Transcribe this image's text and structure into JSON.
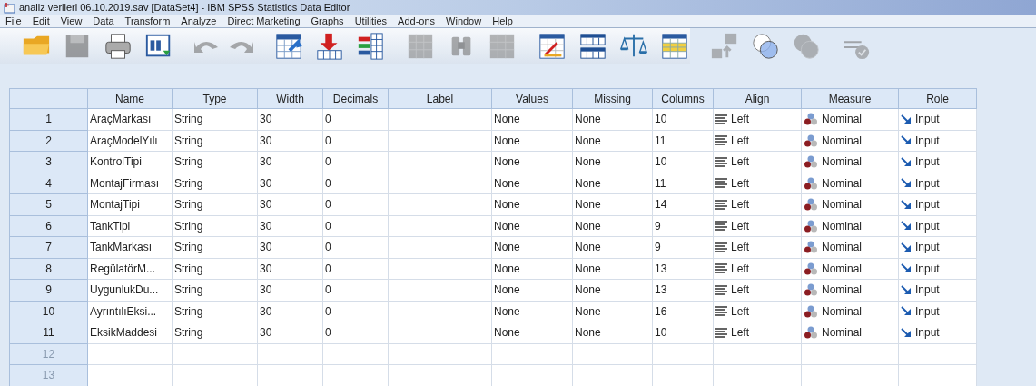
{
  "window": {
    "title": "analiz verileri 06.10.2019.sav [DataSet4] - IBM SPSS Statistics Data Editor"
  },
  "menu": [
    "File",
    "Edit",
    "View",
    "Data",
    "Transform",
    "Analyze",
    "Direct Marketing",
    "Graphs",
    "Utilities",
    "Add-ons",
    "Window",
    "Help"
  ],
  "toolbar": [
    {
      "kind": "open",
      "disabled": false
    },
    {
      "kind": "save",
      "disabled": true
    },
    {
      "kind": "print",
      "disabled": false
    },
    {
      "kind": "recall",
      "disabled": false
    },
    {
      "kind": "undo",
      "disabled": true
    },
    {
      "kind": "redo",
      "disabled": true
    },
    {
      "kind": "goto-case",
      "disabled": false
    },
    {
      "kind": "goto-variable",
      "disabled": false
    },
    {
      "kind": "variables",
      "disabled": false
    },
    {
      "kind": "grid",
      "disabled": true
    },
    {
      "kind": "find",
      "disabled": true
    },
    {
      "kind": "grid",
      "disabled": true
    },
    {
      "kind": "chart",
      "disabled": false
    },
    {
      "kind": "split",
      "disabled": false
    },
    {
      "kind": "scale",
      "disabled": false
    },
    {
      "kind": "select",
      "disabled": false
    },
    {
      "kind": "labels",
      "disabled": true
    },
    {
      "kind": "sets",
      "disabled": false
    },
    {
      "kind": "circles",
      "disabled": true
    },
    {
      "kind": "spell",
      "disabled": true
    }
  ],
  "table": {
    "columns": [
      "Name",
      "Type",
      "Width",
      "Decimals",
      "Label",
      "Values",
      "Missing",
      "Columns",
      "Align",
      "Measure",
      "Role"
    ],
    "rows": [
      {
        "number": "1",
        "cells": [
          "AraçMarkası",
          "String",
          "30",
          "0",
          "",
          "None",
          "None",
          "10",
          "Left",
          "Nominal",
          "Input"
        ]
      },
      {
        "number": "2",
        "cells": [
          "AraçModelYılı",
          "String",
          "30",
          "0",
          "",
          "None",
          "None",
          "11",
          "Left",
          "Nominal",
          "Input"
        ]
      },
      {
        "number": "3",
        "cells": [
          "KontrolTipi",
          "String",
          "30",
          "0",
          "",
          "None",
          "None",
          "10",
          "Left",
          "Nominal",
          "Input"
        ]
      },
      {
        "number": "4",
        "cells": [
          "MontajFirması",
          "String",
          "30",
          "0",
          "",
          "None",
          "None",
          "11",
          "Left",
          "Nominal",
          "Input"
        ]
      },
      {
        "number": "5",
        "cells": [
          "MontajTipi",
          "String",
          "30",
          "0",
          "",
          "None",
          "None",
          "14",
          "Left",
          "Nominal",
          "Input"
        ]
      },
      {
        "number": "6",
        "cells": [
          "TankTipi",
          "String",
          "30",
          "0",
          "",
          "None",
          "None",
          "9",
          "Left",
          "Nominal",
          "Input"
        ]
      },
      {
        "number": "7",
        "cells": [
          "TankMarkası",
          "String",
          "30",
          "0",
          "",
          "None",
          "None",
          "9",
          "Left",
          "Nominal",
          "Input"
        ]
      },
      {
        "number": "8",
        "cells": [
          "RegülatörM...",
          "String",
          "30",
          "0",
          "",
          "None",
          "None",
          "13",
          "Left",
          "Nominal",
          "Input"
        ]
      },
      {
        "number": "9",
        "cells": [
          "UygunlukDu...",
          "String",
          "30",
          "0",
          "",
          "None",
          "None",
          "13",
          "Left",
          "Nominal",
          "Input"
        ]
      },
      {
        "number": "10",
        "cells": [
          "AyrıntılıEksi...",
          "String",
          "30",
          "0",
          "",
          "None",
          "None",
          "16",
          "Left",
          "Nominal",
          "Input"
        ]
      },
      {
        "number": "11",
        "cells": [
          "EksikMaddesi",
          "String",
          "30",
          "0",
          "",
          "None",
          "None",
          "10",
          "Left",
          "Nominal",
          "Input"
        ]
      },
      {
        "number": "12"
      },
      {
        "number": "13"
      }
    ]
  }
}
